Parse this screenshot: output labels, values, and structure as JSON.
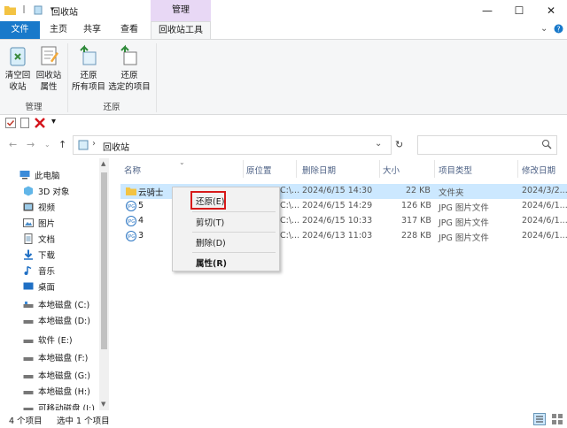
{
  "window": {
    "title": "回收站",
    "context_tab": "管理",
    "controls": {
      "minimize": "—",
      "maximize": "☐",
      "close": "✕"
    }
  },
  "ribbon_tabs": {
    "file": "文件",
    "home": "主页",
    "share": "共享",
    "view": "查看",
    "recycle_tools": "回收站工具"
  },
  "ribbon": {
    "empty_bin": [
      "清空回",
      "收站"
    ],
    "bin_props": [
      "回收站",
      "属性"
    ],
    "group_manage": "管理",
    "restore_all": [
      "还原",
      "所有项目"
    ],
    "restore_selected": [
      "还原",
      "选定的项目"
    ],
    "group_restore": "还原"
  },
  "address": {
    "path": "回收站"
  },
  "nav": {
    "items": [
      "此电脑",
      "3D 对象",
      "视频",
      "图片",
      "文档",
      "下载",
      "音乐",
      "桌面",
      "本地磁盘 (C:)",
      "本地磁盘 (D:)",
      "软件 (E:)",
      "本地磁盘 (F:)",
      "本地磁盘 (G:)",
      "本地磁盘 (H:)",
      "可移动磁盘 (I:)"
    ]
  },
  "columns": [
    "名称",
    "原位置",
    "删除日期",
    "大小",
    "项目类型",
    "修改日期"
  ],
  "files": [
    {
      "name": "云骑士",
      "orig": "C:\\...",
      "deleted": "2024/6/15 14:30",
      "size": "22 KB",
      "type": "文件夹",
      "modified": "2024/3/2..."
    },
    {
      "name": "5",
      "orig": "C:\\...",
      "deleted": "2024/6/15 14:29",
      "size": "126 KB",
      "type": "JPG 图片文件",
      "modified": "2024/6/1..."
    },
    {
      "name": "4",
      "orig": "C:\\...",
      "deleted": "2024/6/15 10:33",
      "size": "317 KB",
      "type": "JPG 图片文件",
      "modified": "2024/6/1..."
    },
    {
      "name": "3",
      "orig": "C:\\...",
      "deleted": "2024/6/13 11:03",
      "size": "228 KB",
      "type": "JPG 图片文件",
      "modified": "2024/6/1..."
    }
  ],
  "context_menu": {
    "restore": "还原(E)",
    "cut": "剪切(T)",
    "delete": "删除(D)",
    "properties": "属性(R)"
  },
  "status": {
    "count": "4 个项目",
    "selected": "选中 1 个项目"
  },
  "colors": {
    "accent": "#1979ca",
    "manage_tab": "#e8d8f5",
    "selection": "#cce8ff",
    "highlight_box": "#d71a1a"
  }
}
